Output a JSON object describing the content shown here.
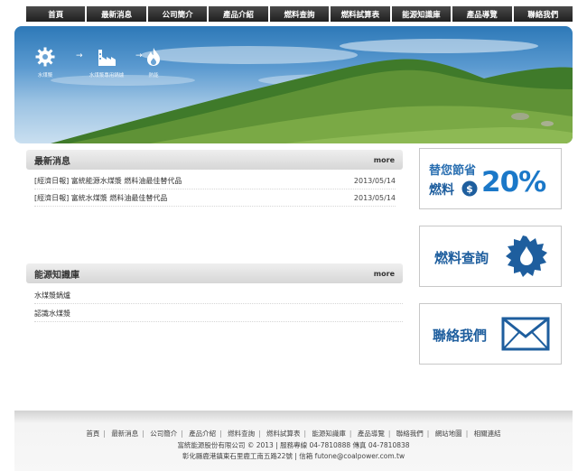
{
  "nav": {
    "items": [
      "首頁",
      "最新消息",
      "公司簡介",
      "產品介紹",
      "燃料查詢",
      "燃料試算表",
      "能源知識庫",
      "產品導覽",
      "聯絡我們"
    ]
  },
  "banner": {
    "steps": [
      {
        "icon": "gear-icon",
        "caption": "水煤漿"
      },
      {
        "icon": "factory-icon",
        "caption": "水煤漿專用鍋爐"
      },
      {
        "icon": "flame-icon",
        "caption": "熱能"
      }
    ],
    "arrow": "→"
  },
  "news": {
    "title": "最新消息",
    "more": "more",
    "items": [
      {
        "text": "[經濟日報] 富統能源水煤漿 燃料油最佳替代品",
        "date": "2013/05/14"
      },
      {
        "text": "[經濟日報] 富統水煤漿 燃料油最佳替代品",
        "date": "2013/05/14"
      }
    ]
  },
  "kb": {
    "title": "能源知識庫",
    "more": "more",
    "items": [
      "水煤漿鍋爐",
      "認識水煤漿"
    ]
  },
  "side": {
    "save": {
      "line1": "替您節省",
      "line2": "燃料",
      "percent": "20%"
    },
    "fuel": {
      "label": "燃料查詢"
    },
    "contact": {
      "label": "聯絡我們"
    }
  },
  "footer": {
    "links": [
      "首頁",
      "最新消息",
      "公司簡介",
      "產品介紹",
      "燃料查詢",
      "燃料試算表",
      "能源知識庫",
      "產品導覽",
      "聯絡我們",
      "網站地圖",
      "相關連結"
    ],
    "company": "富統能源股份有限公司 © 2013 | 服務專線 04-7810888 傳真 04-7810838",
    "address": "彰化縣鹿港鎮東石里鹿工南五路22號 | 信箱 futone@coalpower.com.tw"
  },
  "colors": {
    "nav_bg": "#2b2b2b",
    "accent_blue": "#1e5e9e",
    "percent_blue": "#1b78c8"
  }
}
